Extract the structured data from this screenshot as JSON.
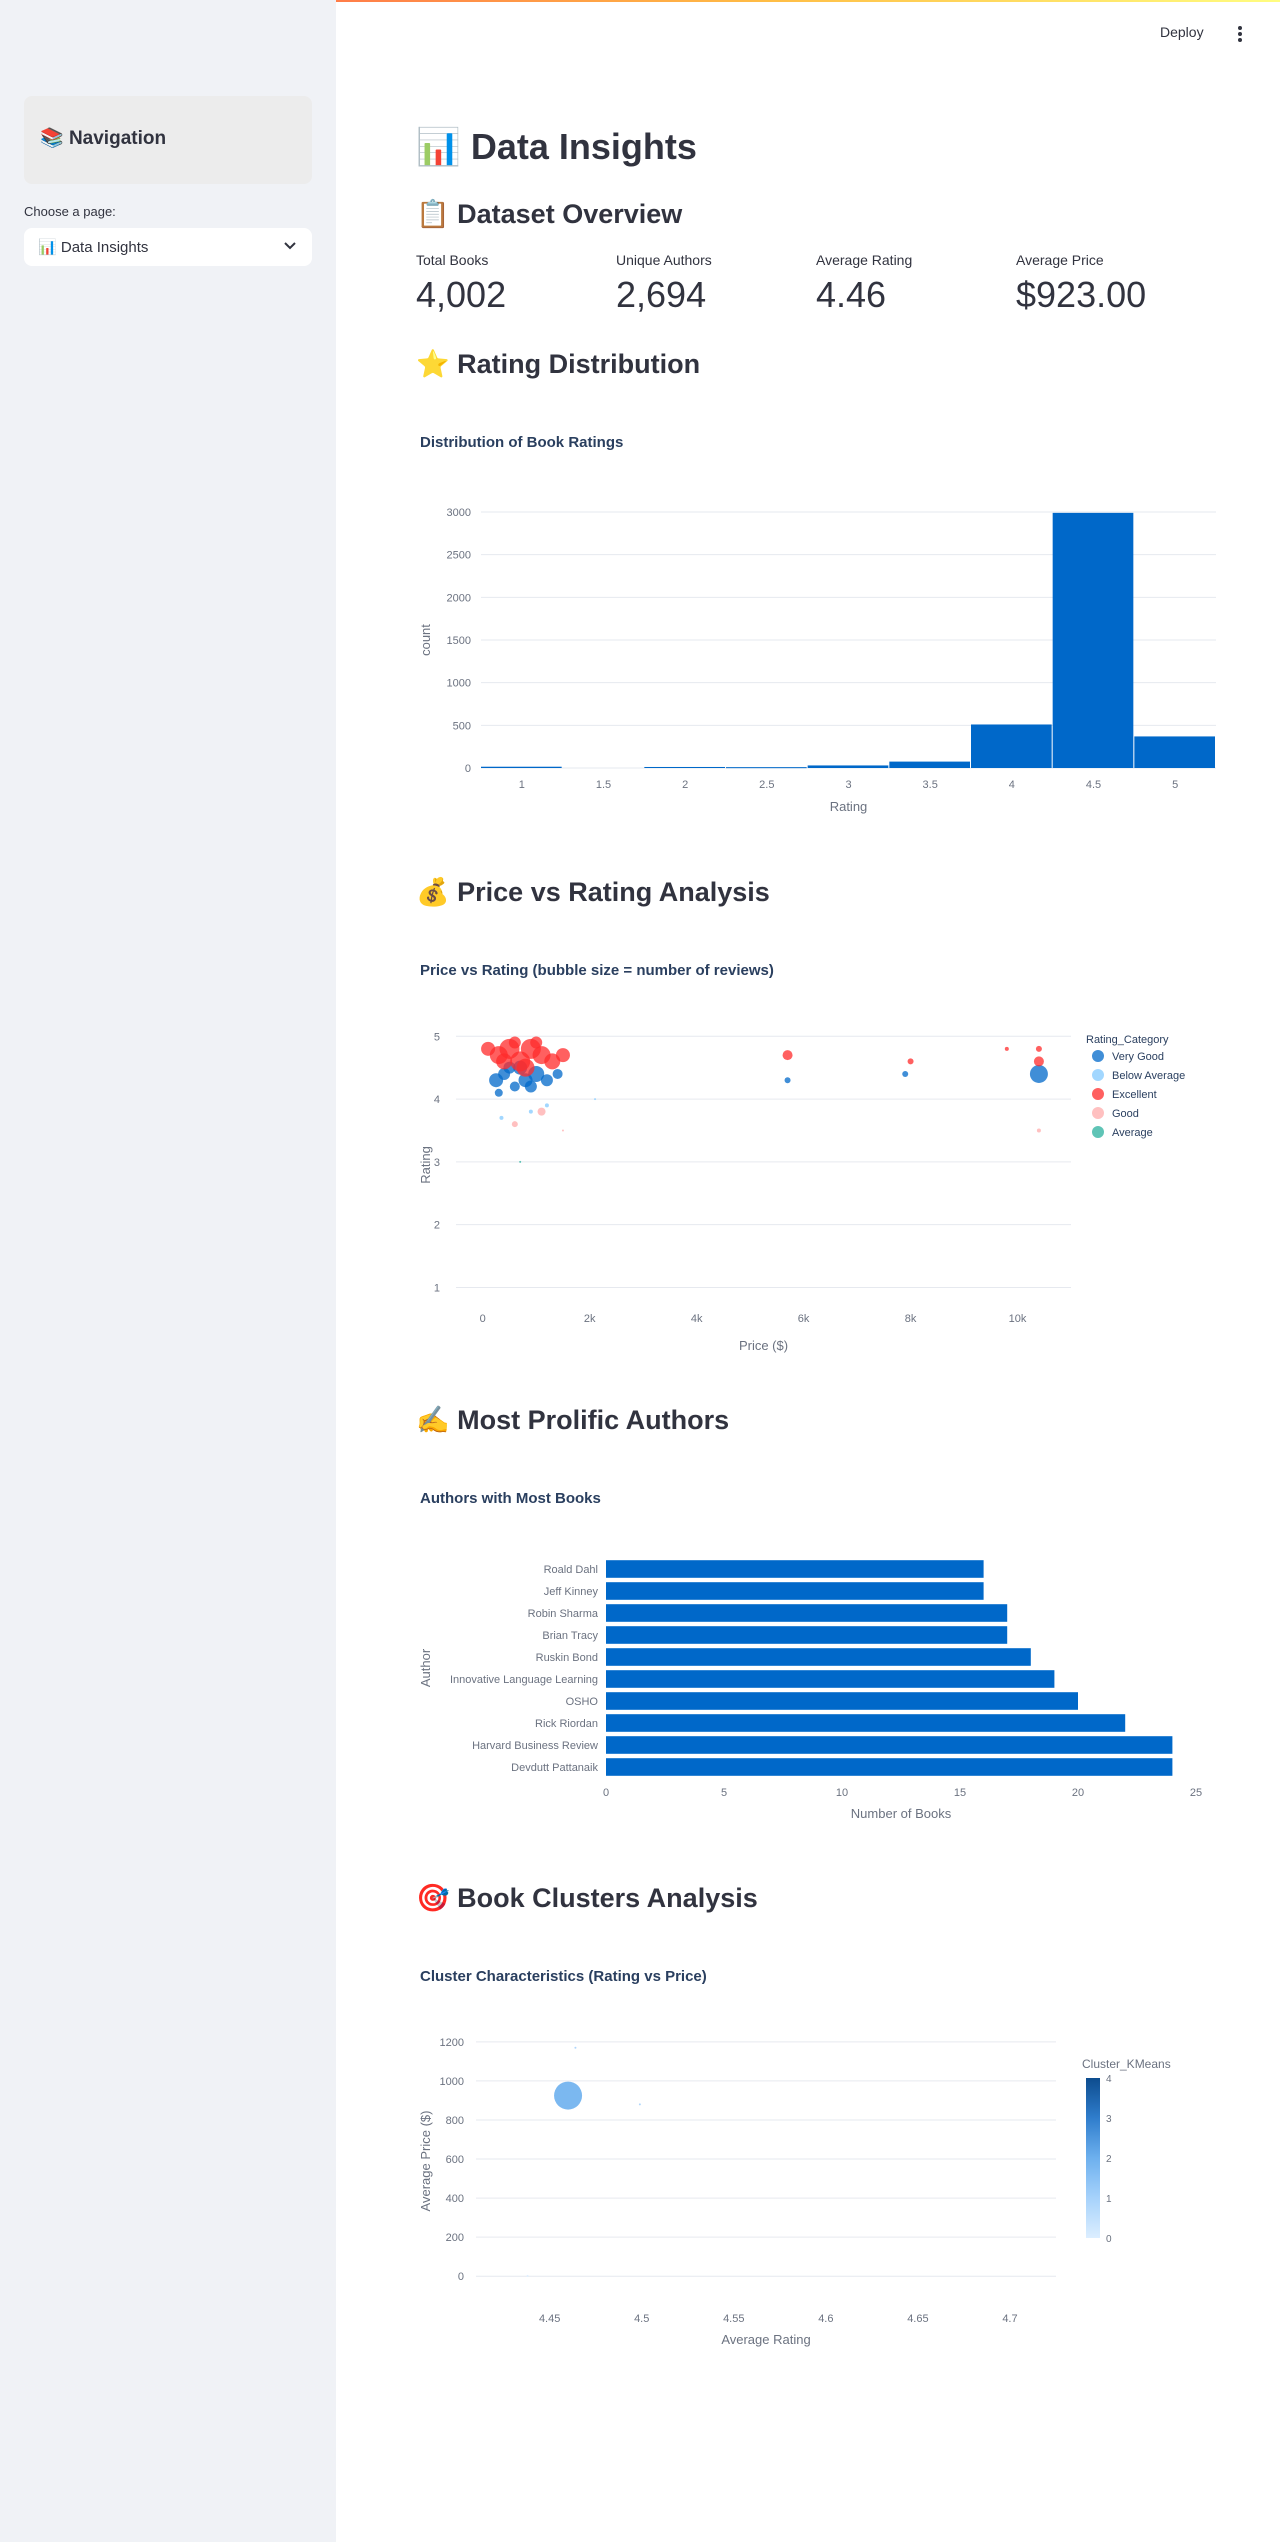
{
  "app": {
    "deploy_label": "Deploy",
    "menu_icon": "kebab-menu-icon"
  },
  "sidebar": {
    "nav_emoji": "📚",
    "nav_title": "Navigation",
    "choose_label": "Choose a page:",
    "selected_emoji": "📊",
    "selected_page": "Data Insights",
    "dropdown_icon": "chevron-down-icon"
  },
  "main": {
    "title_emoji": "📊",
    "title": "Data Insights",
    "overview_emoji": "📋",
    "overview_heading": "Dataset Overview",
    "metrics": [
      {
        "label": "Total Books",
        "value": "4,002"
      },
      {
        "label": "Unique Authors",
        "value": "2,694"
      },
      {
        "label": "Average Rating",
        "value": "4.46"
      },
      {
        "label": "Average Price",
        "value": "$923.00"
      }
    ],
    "rating_emoji": "⭐",
    "rating_heading": "Rating Distribution",
    "price_emoji": "💰",
    "price_heading": "Price vs Rating Analysis",
    "authors_emoji": "✍️",
    "authors_heading": "Most Prolific Authors",
    "clusters_emoji": "🎯",
    "clusters_heading": "Book Clusters Analysis"
  },
  "colors": {
    "bar_blue": "#0068c9",
    "light_blue": "#83c9ff",
    "red": "#ff2b2b",
    "pink": "#ffabab",
    "teal": "#29b09d",
    "axis_text": "#6b7280",
    "grid": "#e6e9ef"
  },
  "chart_data": [
    {
      "type": "bar",
      "title": "Distribution of Book Ratings",
      "xlabel": "Rating",
      "ylabel": "count",
      "bin_width": 0.5,
      "bins": [
        {
          "x0": 0.75,
          "x1": 1.25,
          "count": 15
        },
        {
          "x0": 1.75,
          "x1": 2.25,
          "count": 12
        },
        {
          "x0": 2.25,
          "x1": 2.75,
          "count": 10
        },
        {
          "x0": 2.75,
          "x1": 3.25,
          "count": 30
        },
        {
          "x0": 3.25,
          "x1": 3.75,
          "count": 75
        },
        {
          "x0": 3.75,
          "x1": 4.25,
          "count": 510
        },
        {
          "x0": 4.25,
          "x1": 4.75,
          "count": 2990
        },
        {
          "x0": 4.75,
          "x1": 5.25,
          "count": 370
        }
      ],
      "xticks": [
        "1",
        "1.5",
        "2",
        "2.5",
        "3",
        "3.5",
        "4",
        "4.5",
        "5"
      ],
      "yticks": [
        "0",
        "500",
        "1000",
        "1500",
        "2000",
        "2500",
        "3000"
      ],
      "xlim": [
        0.75,
        5.25
      ],
      "ylim": [
        0,
        3000
      ]
    },
    {
      "type": "scatter",
      "title": "Price vs Rating (bubble size = number of reviews)",
      "xlabel": "Price ($)",
      "ylabel": "Rating",
      "xlim": [
        -500,
        11000
      ],
      "ylim": [
        0.8,
        5.1
      ],
      "xticks": [
        {
          "v": 0,
          "t": "0"
        },
        {
          "v": 2000,
          "t": "2k"
        },
        {
          "v": 4000,
          "t": "4k"
        },
        {
          "v": 6000,
          "t": "6k"
        },
        {
          "v": 8000,
          "t": "8k"
        },
        {
          "v": 10000,
          "t": "10k"
        }
      ],
      "yticks": [
        "1",
        "2",
        "3",
        "4",
        "5"
      ],
      "legend_title": "Rating_Category",
      "legend_position": "right",
      "series": [
        {
          "name": "Very Good",
          "color": "#0068c9",
          "points": [
            [
              250,
              4.3,
              7
            ],
            [
              400,
              4.4,
              6
            ],
            [
              600,
              4.2,
              5
            ],
            [
              800,
              4.3,
              7
            ],
            [
              1000,
              4.4,
              8
            ],
            [
              1200,
              4.3,
              6
            ],
            [
              300,
              4.1,
              4
            ],
            [
              900,
              4.2,
              6
            ],
            [
              1400,
              4.4,
              5
            ],
            [
              5700,
              4.3,
              3
            ],
            [
              7900,
              4.4,
              3
            ],
            [
              10400,
              4.4,
              9
            ],
            [
              500,
              4.5,
              6
            ],
            [
              700,
              4.5,
              7
            ]
          ]
        },
        {
          "name": "Below Average",
          "color": "#83c9ff",
          "points": [
            [
              350,
              3.7,
              2
            ],
            [
              900,
              3.8,
              2
            ],
            [
              1200,
              3.9,
              2
            ],
            [
              2100,
              4.0,
              1
            ]
          ]
        },
        {
          "name": "Excellent",
          "color": "#ff2b2b",
          "points": [
            [
              100,
              4.8,
              7
            ],
            [
              300,
              4.7,
              9
            ],
            [
              500,
              4.8,
              10
            ],
            [
              700,
              4.6,
              10
            ],
            [
              900,
              4.8,
              10
            ],
            [
              1100,
              4.7,
              9
            ],
            [
              1300,
              4.6,
              8
            ],
            [
              1500,
              4.7,
              7
            ],
            [
              600,
              4.9,
              6
            ],
            [
              1000,
              4.9,
              6
            ],
            [
              400,
              4.6,
              8
            ],
            [
              800,
              4.5,
              9
            ],
            [
              5700,
              4.7,
              5
            ],
            [
              8000,
              4.6,
              3
            ],
            [
              9800,
              4.8,
              2
            ],
            [
              10400,
              4.6,
              5
            ],
            [
              10400,
              4.8,
              3
            ]
          ]
        },
        {
          "name": "Good",
          "color": "#ffabab",
          "points": [
            [
              600,
              3.6,
              3
            ],
            [
              1100,
              3.8,
              4
            ],
            [
              1500,
              3.5,
              1
            ],
            [
              10400,
              3.5,
              2
            ]
          ]
        },
        {
          "name": "Average",
          "color": "#29b09d",
          "points": [
            [
              700,
              3.0,
              1
            ]
          ]
        }
      ]
    },
    {
      "type": "bar",
      "orientation": "horizontal",
      "title": "Authors with Most Books",
      "xlabel": "Number of Books",
      "ylabel": "Author",
      "xlim": [
        0,
        25
      ],
      "xticks": [
        "0",
        "5",
        "10",
        "15",
        "20",
        "25"
      ],
      "categories": [
        "Roald Dahl",
        "Jeff Kinney",
        "Robin Sharma",
        "Brian Tracy",
        "Ruskin Bond",
        "Innovative Language Learning",
        "OSHO",
        "Rick Riordan",
        "Harvard Business Review",
        "Devdutt Pattanaik"
      ],
      "values": [
        16,
        16,
        17,
        17,
        18,
        19,
        20,
        22,
        24,
        24
      ]
    },
    {
      "type": "scatter",
      "title": "Cluster Characteristics (Rating vs Price)",
      "xlabel": "Average Rating",
      "ylabel": "Average Price ($)",
      "xlim": [
        4.41,
        4.725
      ],
      "ylim": [
        -50,
        1230
      ],
      "xticks": [
        "4.45",
        "4.5",
        "4.55",
        "4.6",
        "4.65",
        "4.7"
      ],
      "yticks": [
        "0",
        "200",
        "400",
        "600",
        "800",
        "1000",
        "1200"
      ],
      "colorbar_title": "Cluster_KMeans",
      "colorbar_ticks": [
        "0",
        "1",
        "2",
        "3",
        "4"
      ],
      "points": [
        {
          "x": 4.46,
          "y": 925,
          "cluster": 2,
          "size": 14
        },
        {
          "x": 4.464,
          "y": 1170,
          "cluster": 1,
          "size": 1
        },
        {
          "x": 4.499,
          "y": 880,
          "cluster": 1,
          "size": 1
        },
        {
          "x": 4.438,
          "y": 2,
          "cluster": 0,
          "size": 1
        }
      ]
    }
  ]
}
